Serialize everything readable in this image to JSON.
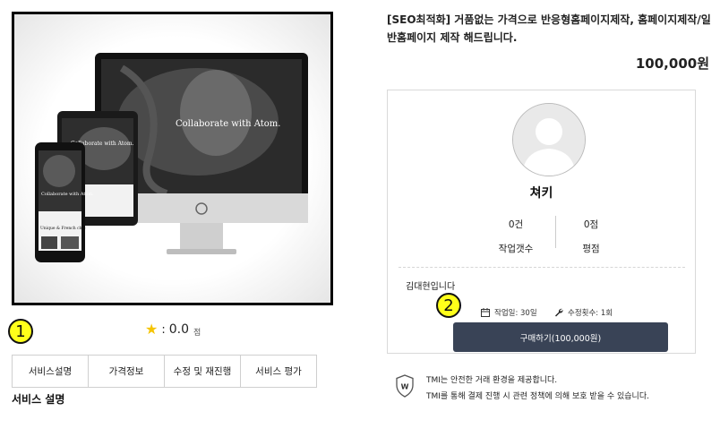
{
  "product": {
    "image_alt": "responsive devices mockup",
    "screen_texts": [
      "Collaborate with Atom.",
      "Collaborate with Atom.",
      "Collaborate with Atom.",
      "Unique & French chic"
    ],
    "rating_star": "★",
    "rating_colon": ":",
    "rating_value": "0.0",
    "rating_unit": "점"
  },
  "markers": [
    "1",
    "2"
  ],
  "tabs": [
    {
      "label": "서비스설명"
    },
    {
      "label": "가격정보"
    },
    {
      "label": "수정 및 재진행"
    },
    {
      "label": "서비스 평가"
    }
  ],
  "section_title": "서비스 설명",
  "listing": {
    "title": "[SEO최적화] 거품없는 가격으로 반응형홈페이지제작, 홈페이지제작/일반홈페이지 제작 해드립니다.",
    "price": "100,000원"
  },
  "seller": {
    "name": "쳐키",
    "stats": [
      {
        "value": "0건",
        "label": "작업갯수"
      },
      {
        "value": "0점",
        "label": "평점"
      }
    ],
    "intro": "김대현입니다",
    "work_days_label": "작업일: 30일",
    "revisions_label": "수정횟수: 1회",
    "buy_button": "구매하기(100,000원)"
  },
  "safety": {
    "badge": "W",
    "line1": "TMI는 안전한 거래 환경을 제공합니다.",
    "line2": "TMI를 통해 결제 진행 시 관련 정책에 의해 보호 받을 수 있습니다."
  },
  "colors": {
    "button": "#394356",
    "marker": "#ffff1a",
    "star": "#f5c400"
  }
}
